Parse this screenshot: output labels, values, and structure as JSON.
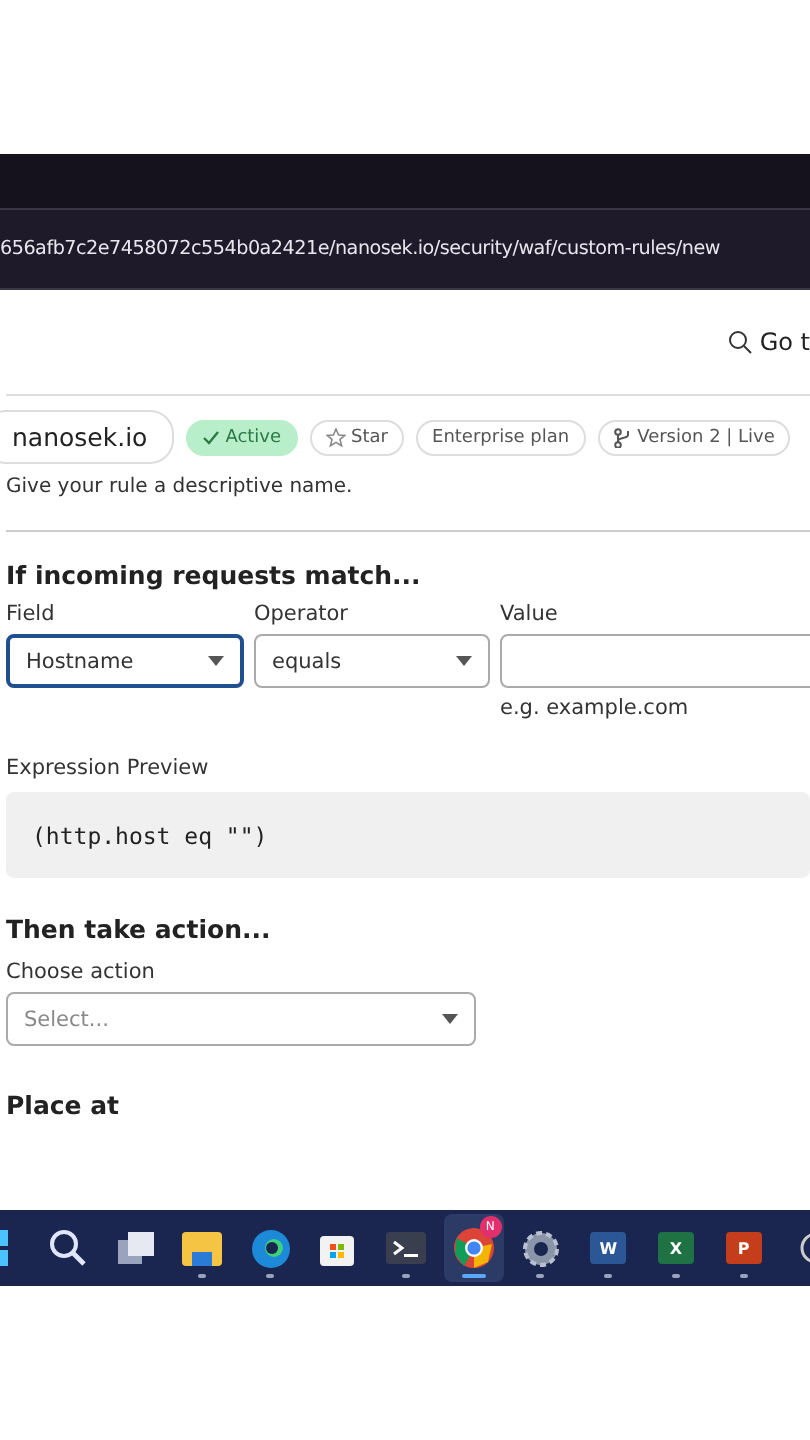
{
  "browser": {
    "url": "656afb7c2e7458072c554b0a2421e/nanosek.io/security/waf/custom-rules/new"
  },
  "header": {
    "search_label": "Go t"
  },
  "chips": [
    {
      "kind": "crumb",
      "label": "nanosek.io"
    },
    {
      "kind": "status",
      "label": "Active"
    },
    {
      "kind": "star",
      "label": "Star"
    },
    {
      "kind": "plain",
      "label": "Enterprise plan"
    },
    {
      "kind": "version",
      "label": "Version 2 | Live"
    }
  ],
  "name_hint": "Give your rule a descriptive name.",
  "match": {
    "heading": "If incoming requests match...",
    "field": {
      "label": "Field",
      "value": "Hostname",
      "focused": true
    },
    "operator": {
      "label": "Operator",
      "value": "equals",
      "focused": false
    },
    "value": {
      "label": "Value",
      "hint": "e.g. example.com"
    }
  },
  "preview": {
    "label": "Expression Preview",
    "code": "(http.host eq \"\")"
  },
  "action": {
    "heading": "Then take action...",
    "label": "Choose action",
    "placeholder": "Select..."
  },
  "place": {
    "heading": "Place at"
  },
  "taskbar": [
    {
      "kind": "start",
      "selected": false,
      "running": false
    },
    {
      "kind": "search",
      "selected": false,
      "running": false
    },
    {
      "kind": "taskview",
      "selected": false,
      "running": false
    },
    {
      "kind": "folder",
      "selected": false,
      "running": true
    },
    {
      "kind": "edge",
      "selected": false,
      "running": true
    },
    {
      "kind": "store",
      "selected": false,
      "running": false
    },
    {
      "kind": "terminal",
      "selected": false,
      "running": true
    },
    {
      "kind": "chrome",
      "selected": true,
      "running": true,
      "badge": "N"
    },
    {
      "kind": "settings",
      "selected": false,
      "running": true
    },
    {
      "kind": "word",
      "label": "W",
      "selected": false,
      "running": true
    },
    {
      "kind": "excel",
      "label": "X",
      "selected": false,
      "running": true
    },
    {
      "kind": "powerpoint",
      "label": "P",
      "selected": false,
      "running": true
    },
    {
      "kind": "circle",
      "selected": false,
      "running": false
    }
  ]
}
